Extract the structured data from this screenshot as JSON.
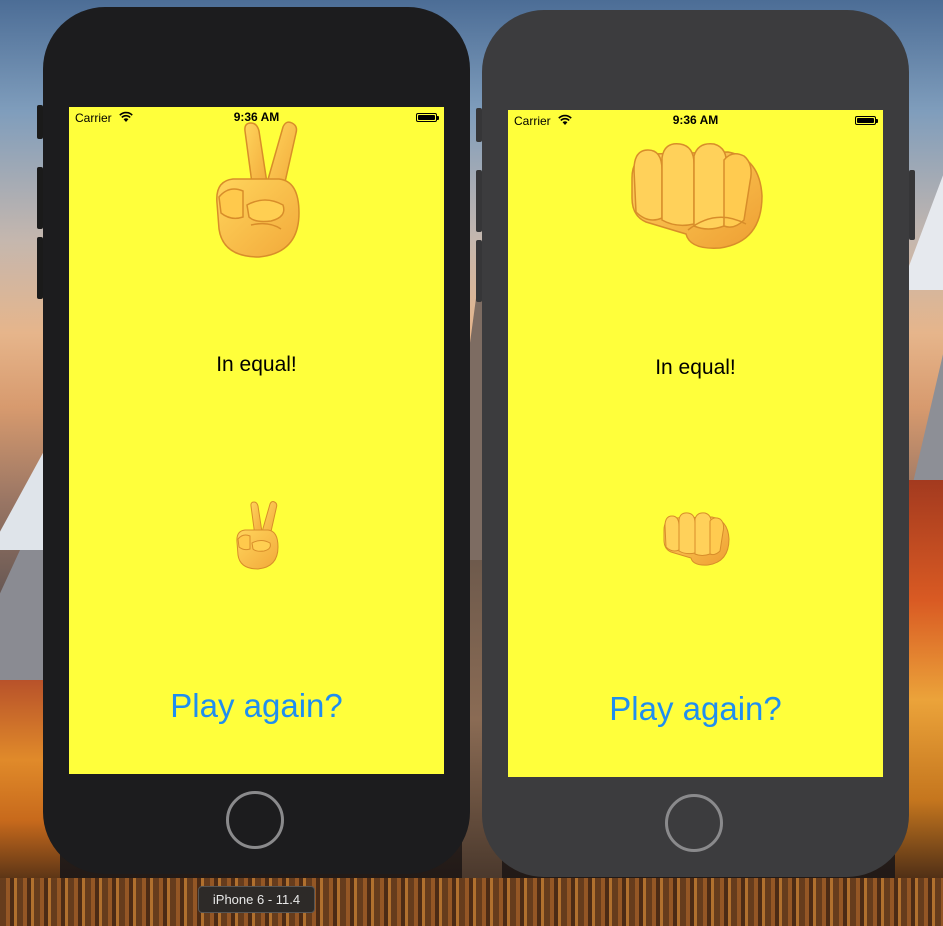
{
  "simulator": {
    "device_label": "iPhone 6 - 11.4"
  },
  "devices": [
    {
      "status_bar": {
        "carrier": "Carrier",
        "time": "9:36 AM"
      },
      "computer_sign": "victory-hand",
      "result_text": "In equal!",
      "player_sign": "victory-hand",
      "play_again_label": "Play again?"
    },
    {
      "status_bar": {
        "carrier": "Carrier",
        "time": "9:36 AM"
      },
      "computer_sign": "oncoming-fist",
      "result_text": "In equal!",
      "player_sign": "oncoming-fist",
      "play_again_label": "Play again?"
    }
  ],
  "colors": {
    "screen_background": "#ffff3b",
    "play_again_text": "#1f8ef0",
    "phone_left_body": "#1c1c1e",
    "phone_right_body": "#3c3c3e"
  },
  "icons": [
    "wifi-icon",
    "battery-icon",
    "victory-hand-icon",
    "fist-icon",
    "home-button"
  ]
}
